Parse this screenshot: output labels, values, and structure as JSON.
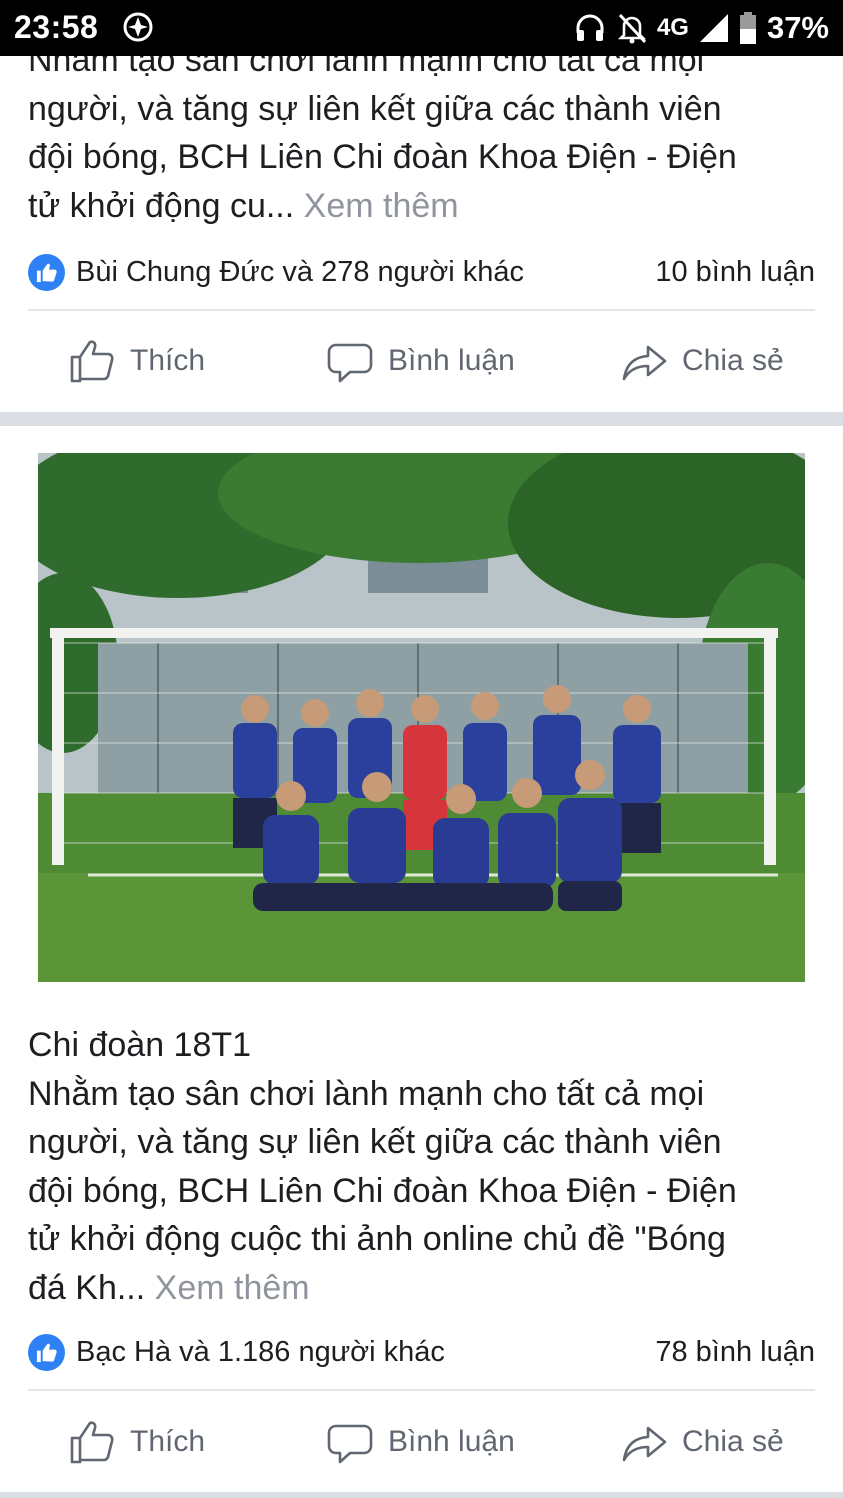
{
  "status_bar": {
    "time": "23:58",
    "network": "4G",
    "battery": "37%",
    "icons": [
      "app-icon",
      "headset-icon",
      "mute-bell-icon",
      "signal-icon",
      "battery-icon"
    ]
  },
  "post1": {
    "text_lines": [
      "Nhằm tạo sân chơi lành mạnh cho tất cả mọi",
      "người, và tăng sự liên kết giữa các thành viên",
      "đội bóng, BCH Liên Chi đoàn Khoa Điện - Điện"
    ],
    "last_line": "tử khởi động cu...",
    "see_more": "Xem thêm",
    "reactors": "Bùi Chung Đức và 278 người khác",
    "comments": "10 bình luận"
  },
  "post2": {
    "author": "Chi đoàn 18T1",
    "text_lines": [
      "Nhằm tạo sân chơi lành mạnh cho tất cả mọi",
      "người, và tăng sự liên kết giữa các thành viên",
      "đội bóng, BCH Liên Chi đoàn Khoa Điện - Điện",
      "tử khởi động cuộc thi ảnh online chủ đề \"Bóng"
    ],
    "last_line": "đá Kh...",
    "see_more": "Xem thêm",
    "reactors": "Bạc Hà và 1.186 người khác",
    "comments": "78 bình luận"
  },
  "actions": {
    "like": "Thích",
    "comment": "Bình luận",
    "share": "Chia sẻ"
  },
  "colors": {
    "like_blue": "#2e80f5",
    "secondary_text": "#606770",
    "see_more": "#90949c",
    "separator": "#dadde1"
  }
}
